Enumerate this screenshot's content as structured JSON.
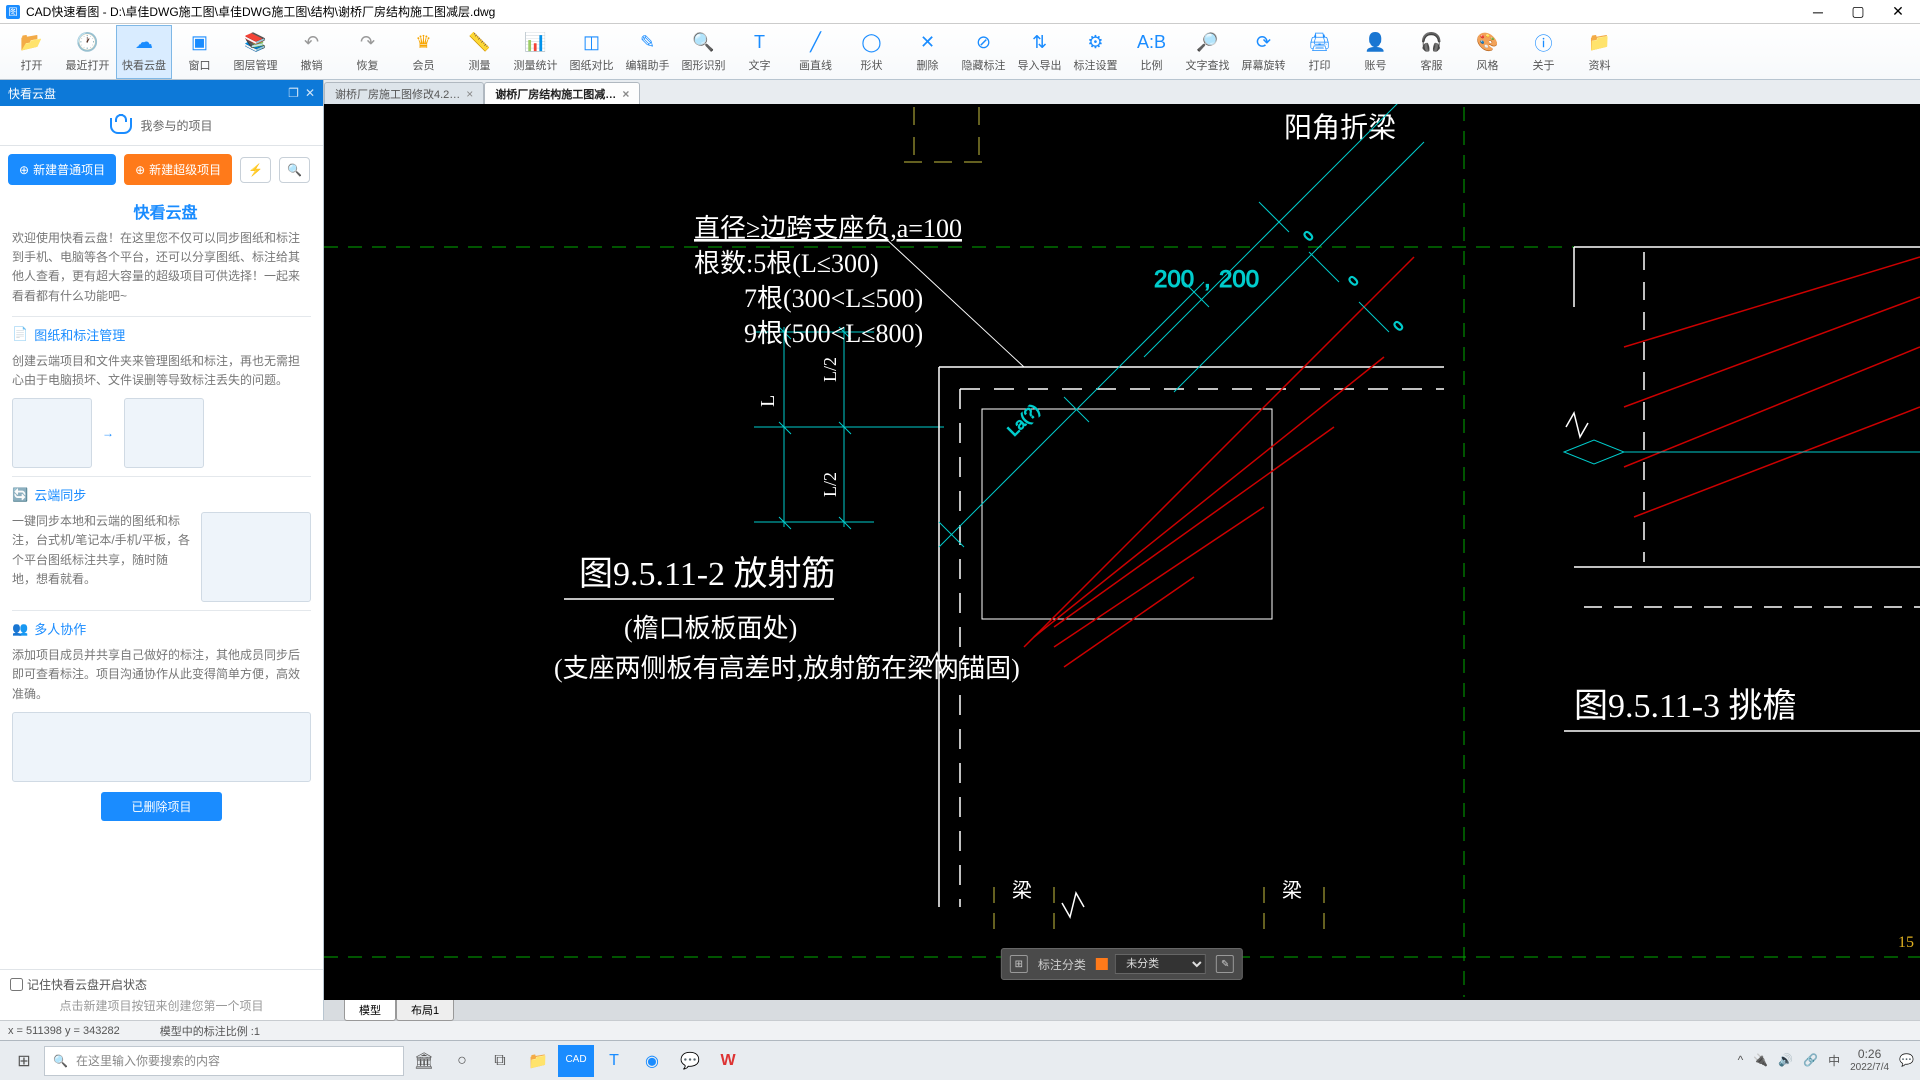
{
  "title": "CAD快速看图 - D:\\卓佳DWG施工图\\卓佳DWG施工图\\结构\\谢桥厂房结构施工图减层.dwg",
  "toolbar": [
    {
      "id": "open",
      "label": "打开",
      "icon": "📂"
    },
    {
      "id": "recent",
      "label": "最近打开",
      "icon": "🕐"
    },
    {
      "id": "cloud",
      "label": "快看云盘",
      "icon": "☁",
      "active": true
    },
    {
      "id": "window",
      "label": "窗口",
      "icon": "▣"
    },
    {
      "id": "layer",
      "label": "图层管理",
      "icon": "📚"
    },
    {
      "id": "undo",
      "label": "撤销",
      "icon": "↶",
      "gray": true
    },
    {
      "id": "redo",
      "label": "恢复",
      "icon": "↷",
      "gray": true
    },
    {
      "id": "vip",
      "label": "会员",
      "icon": "♛",
      "gold": true
    },
    {
      "id": "measure",
      "label": "测量",
      "icon": "📏"
    },
    {
      "id": "mstat",
      "label": "测量统计",
      "icon": "📊"
    },
    {
      "id": "compare",
      "label": "图纸对比",
      "icon": "◫"
    },
    {
      "id": "edit",
      "label": "编辑助手",
      "icon": "✎"
    },
    {
      "id": "ocr",
      "label": "图形识别",
      "icon": "🔍"
    },
    {
      "id": "text",
      "label": "文字",
      "icon": "T"
    },
    {
      "id": "line",
      "label": "画直线",
      "icon": "╱"
    },
    {
      "id": "shape",
      "label": "形状",
      "icon": "◯"
    },
    {
      "id": "delete",
      "label": "删除",
      "icon": "✕"
    },
    {
      "id": "hide",
      "label": "隐藏标注",
      "icon": "⊘"
    },
    {
      "id": "io",
      "label": "导入导出",
      "icon": "⇅"
    },
    {
      "id": "mset",
      "label": "标注设置",
      "icon": "⚙"
    },
    {
      "id": "scale",
      "label": "比例",
      "icon": "A:B"
    },
    {
      "id": "find",
      "label": "文字查找",
      "icon": "🔎"
    },
    {
      "id": "rotate",
      "label": "屏幕旋转",
      "icon": "⟳"
    },
    {
      "id": "print",
      "label": "打印",
      "icon": "🖨"
    },
    {
      "id": "account",
      "label": "账号",
      "icon": "👤"
    },
    {
      "id": "support",
      "label": "客服",
      "icon": "🎧"
    },
    {
      "id": "style",
      "label": "风格",
      "icon": "🎨"
    },
    {
      "id": "about",
      "label": "关于",
      "icon": "ⓘ"
    },
    {
      "id": "res",
      "label": "资料",
      "icon": "📁"
    }
  ],
  "sidebar": {
    "head": "快看云盘",
    "tab": "我参与的项目",
    "btn_new_normal": "新建普通项目",
    "btn_new_super": "新建超级项目",
    "card_title": "快看云盘",
    "card_text": "欢迎使用快看云盘！在这里您不仅可以同步图纸和标注到手机、电脑等各个平台，还可以分享图纸、标注给其他人查看，更有超大容量的超级项目可供选择！一起来看看都有什么功能吧~",
    "s1_title": "图纸和标注管理",
    "s1_body": "创建云端项目和文件夹来管理图纸和标注，再也无需担心由于电脑损坏、文件误删等导致标注丢失的问题。",
    "s2_title": "云端同步",
    "s2_body": "一键同步本地和云端的图纸和标注，台式机/笔记本/手机/平板，各个平台图纸标注共享，随时随地，想看就看。",
    "s3_title": "多人协作",
    "s3_body": "添加项目成员并共享自己做好的标注，其他成员同步后即可查看标注。项目沟通协作从此变得简单方便，高效准确。",
    "del_btn": "已删除项目",
    "chk": "记住快看云盘开启状态",
    "hint": "点击新建项目按钮来创建您第一个项目"
  },
  "tabs": [
    {
      "label": "谢桥厂房施工图修改4.2…",
      "active": false
    },
    {
      "label": "谢桥厂房结构施工图减…",
      "active": true
    }
  ],
  "drawing": {
    "top_right_label": "阳角折梁",
    "spec1": "直径≥边跨支座负,a=100",
    "spec2": "根数:5根(L≤300)",
    "spec3": "7根(300<L≤500)",
    "spec4": "9根(500<L≤800)",
    "dim1": "200",
    "dim2": "200",
    "dimL": "L",
    "dimL2a": "L/2",
    "dimL2b": "L/2",
    "dimLa": "La(?)",
    "title_main": "图9.5.11-2 放射筋",
    "sub1": "(檐口板板面处)",
    "sub2": "(支座两侧板有高差时,放射筋在梁内锚固)",
    "title_right": "图9.5.11-3  挑檐",
    "beam_l": "梁",
    "beam_r": "梁",
    "ruler": "15"
  },
  "anno": {
    "label": "标注分类",
    "value": "未分类"
  },
  "model_tabs": [
    "模型",
    "布局1"
  ],
  "status": {
    "coords": "x = 511398  y = 343282",
    "scale": "模型中的标注比例 :1"
  },
  "taskbar": {
    "search_ph": "在这里输入你要搜索的内容",
    "time": "0:26",
    "date": "2022/7/4",
    "ime": "中"
  }
}
